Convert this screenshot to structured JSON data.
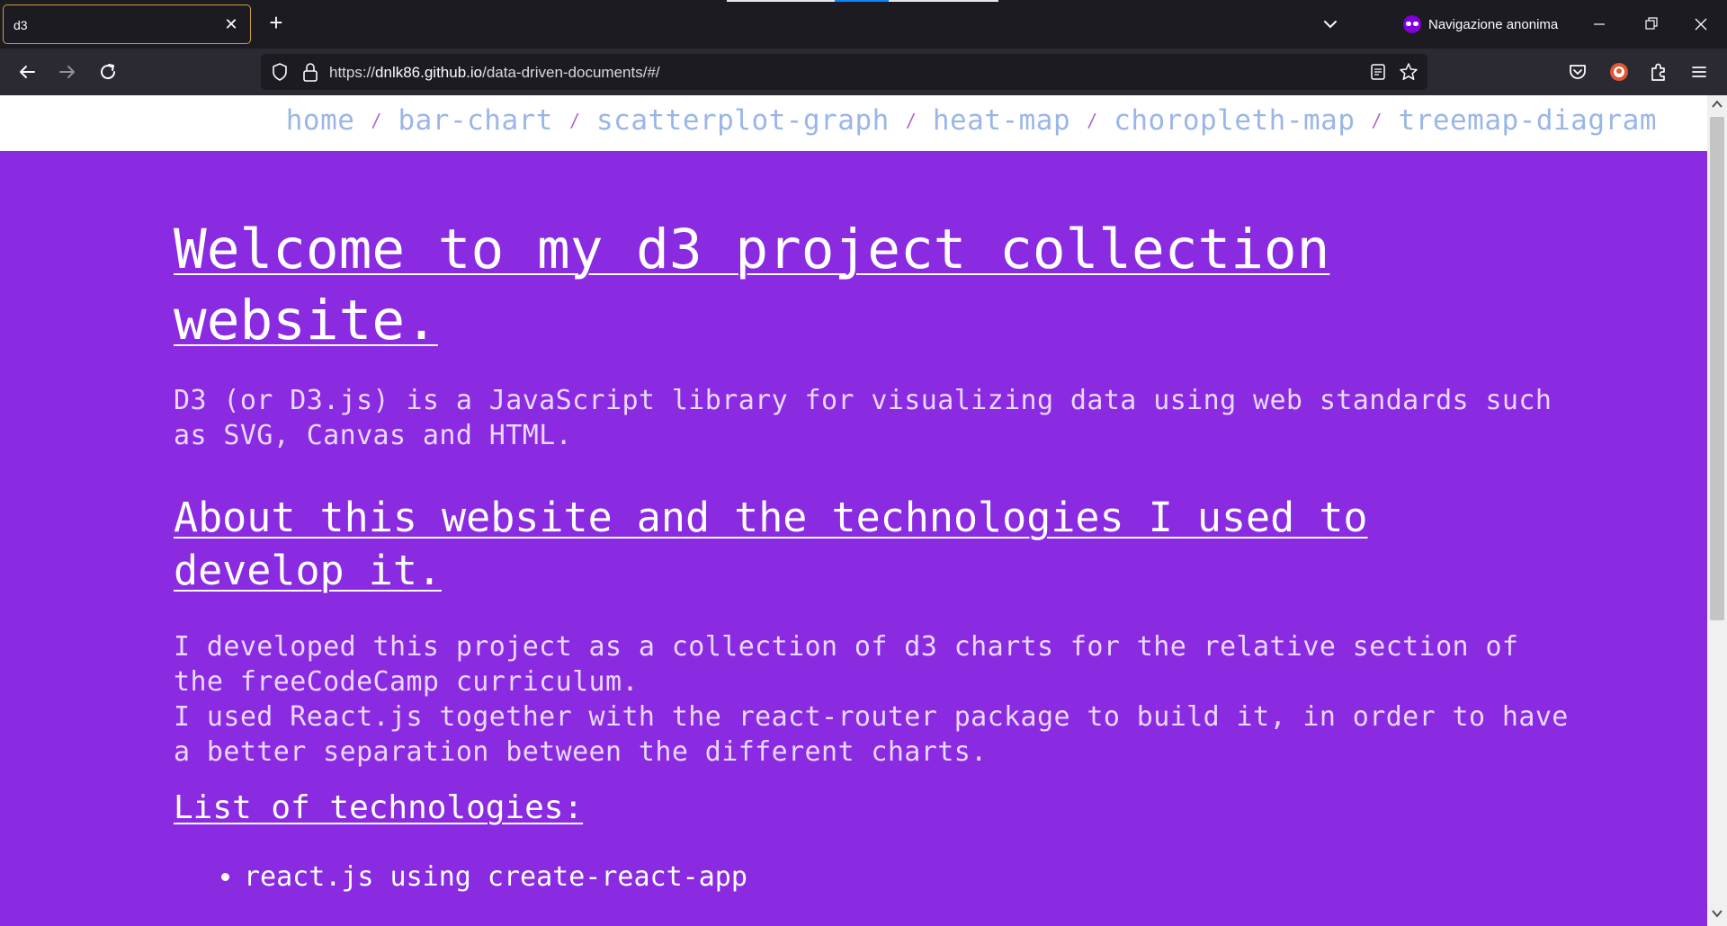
{
  "browser": {
    "tab": {
      "title": "d3"
    },
    "private_label": "Navigazione anonima",
    "url": {
      "protocol": "https://",
      "host": "dnlk86.github.io",
      "path": "/data-driven-documents/#/"
    }
  },
  "site": {
    "breadcrumb": [
      {
        "label": "home"
      },
      {
        "label": "bar-chart"
      },
      {
        "label": "scatterplot-graph"
      },
      {
        "label": "heat-map"
      },
      {
        "label": "choropleth-map"
      },
      {
        "label": "treemap-diagram"
      }
    ],
    "separator": "/",
    "hero_title": "Welcome to my d3 project collection website.",
    "intro": "D3 (or D3.js) is a JavaScript library for visualizing data using web standards such as SVG, Canvas and HTML.",
    "about_title": "About this website and the technologies I used to develop it.",
    "about_paragraph_1": "I developed this project as a collection of d3 charts for the relative section of the freeCodeCamp curriculum.",
    "about_paragraph_2": "I used React.js together with the react-router package to build it, in order to have a better separation between the different charts.",
    "list_title": "List of technologies:",
    "technologies": [
      "react.js using create-react-app"
    ]
  },
  "colors": {
    "page_background": "#8a2be2",
    "header_background": "#ffffff",
    "link": "#9ab6e8",
    "browser_chrome": "#1c1b22",
    "toolbar": "#2b2a33",
    "tab_border": "#c9a23a",
    "private_badge": "#8000d7"
  }
}
